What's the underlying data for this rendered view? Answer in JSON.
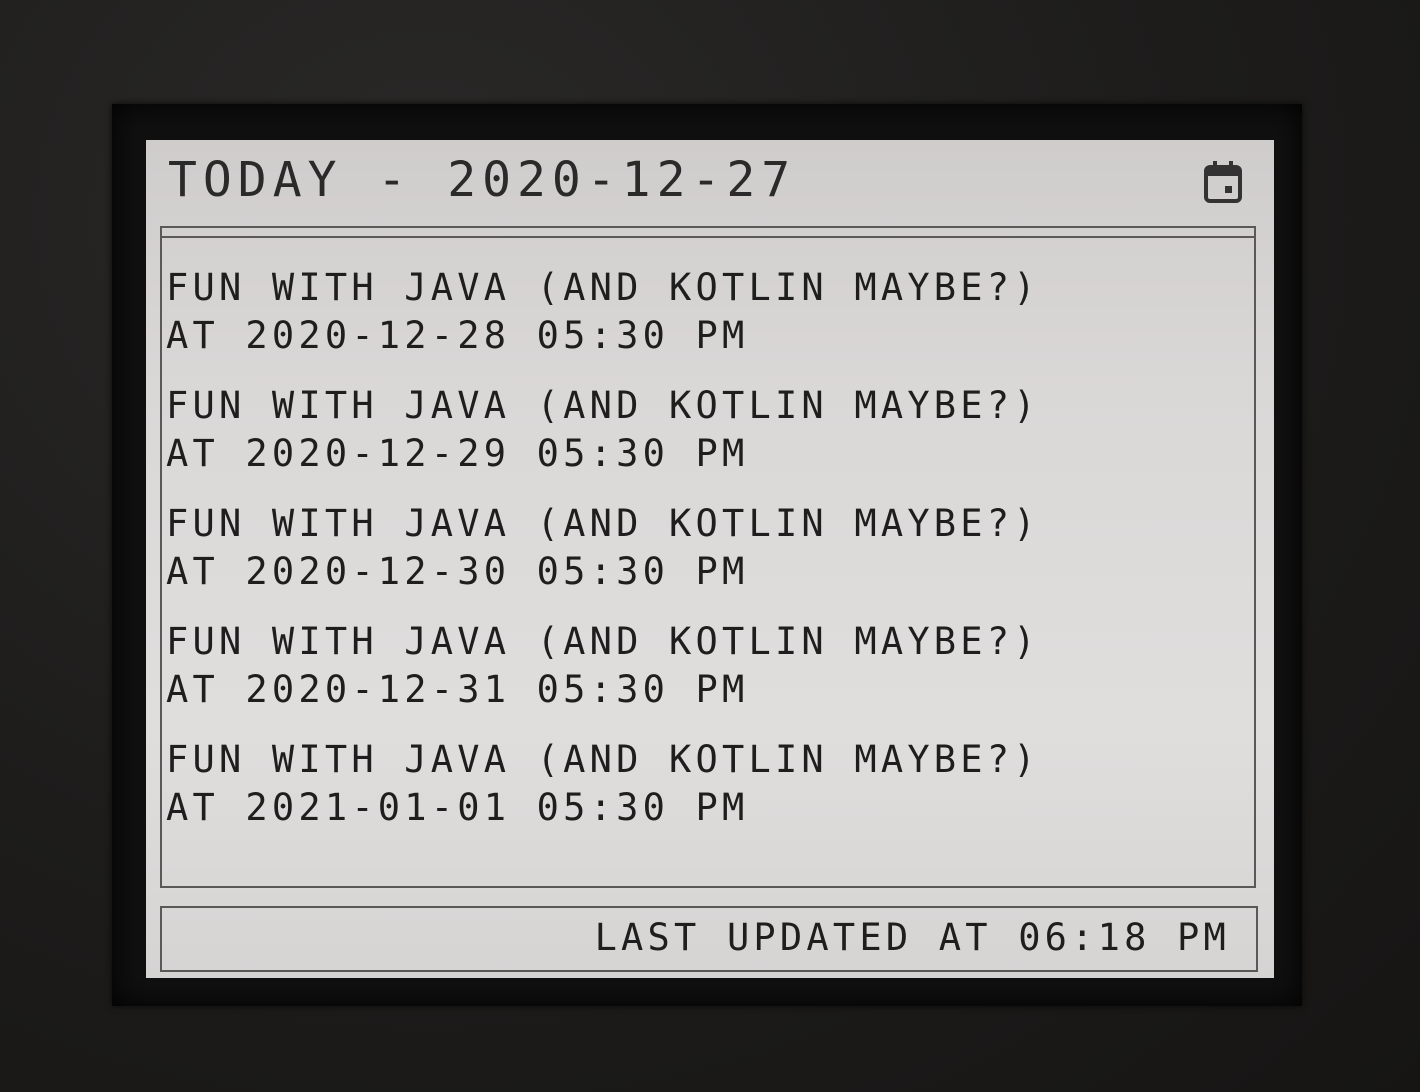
{
  "header": {
    "title": "TODAY - 2020-12-27",
    "icon": "calendar-icon"
  },
  "events": [
    {
      "title": "FUN WITH JAVA (AND KOTLIN MAYBE?)",
      "time": "AT 2020-12-28 05:30 PM"
    },
    {
      "title": "FUN WITH JAVA (AND KOTLIN MAYBE?)",
      "time": "AT 2020-12-29 05:30 PM"
    },
    {
      "title": "FUN WITH JAVA (AND KOTLIN MAYBE?)",
      "time": "AT 2020-12-30 05:30 PM"
    },
    {
      "title": "FUN WITH JAVA (AND KOTLIN MAYBE?)",
      "time": "AT 2020-12-31 05:30 PM"
    },
    {
      "title": "FUN WITH JAVA (AND KOTLIN MAYBE?)",
      "time": "AT 2021-01-01 05:30 PM"
    }
  ],
  "footer": {
    "status": "LAST UPDATED AT 06:18 PM"
  },
  "colors": {
    "screen": "#dad8d7",
    "ink": "#1e1e1e",
    "frame": "#1c1b1a"
  }
}
